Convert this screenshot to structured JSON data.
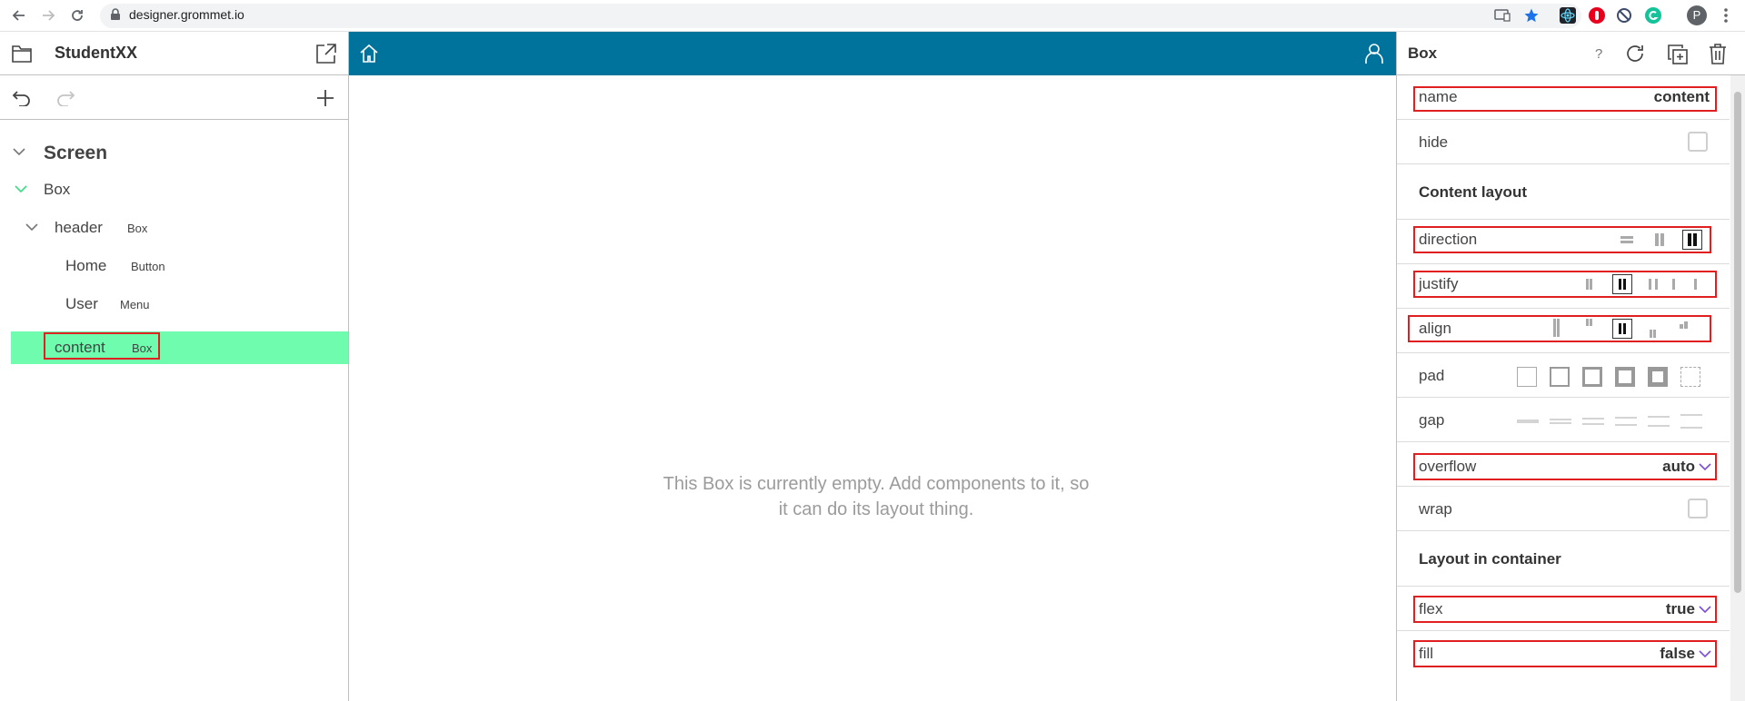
{
  "browser": {
    "url": "designer.grommet.io",
    "profile_initial": "P"
  },
  "left_panel": {
    "app_title": "StudentXX",
    "tree": [
      {
        "label": "Screen",
        "type": ""
      },
      {
        "label": "Box",
        "type": ""
      },
      {
        "label": "header",
        "type": "Box"
      },
      {
        "label": "Home",
        "type": "Button"
      },
      {
        "label": "User",
        "type": "Menu"
      },
      {
        "label": "content",
        "type": "Box"
      }
    ]
  },
  "canvas": {
    "empty_message_line1": "This Box is currently empty. Add components to it, so",
    "empty_message_line2": "it can do its layout thing.",
    "header_color": "#00739d"
  },
  "right_panel": {
    "title": "Box",
    "help": "?",
    "props": {
      "name": {
        "label": "name",
        "value": "content"
      },
      "hide": {
        "label": "hide"
      },
      "content_layout": "Content layout",
      "direction": {
        "label": "direction"
      },
      "justify": {
        "label": "justify"
      },
      "align": {
        "label": "align"
      },
      "pad": {
        "label": "pad"
      },
      "gap": {
        "label": "gap"
      },
      "overflow": {
        "label": "overflow",
        "value": "auto"
      },
      "wrap": {
        "label": "wrap"
      },
      "layout_in_container": "Layout in container",
      "flex": {
        "label": "flex",
        "value": "true"
      },
      "fill": {
        "label": "fill",
        "value": "false"
      }
    }
  },
  "colors": {
    "selected_row": "#6ffcae",
    "highlight": "#e02020",
    "accent_chevron": "#7d4cdb"
  }
}
